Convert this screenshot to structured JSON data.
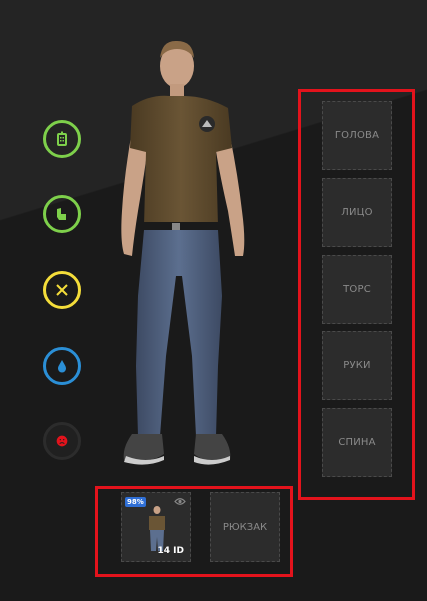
{
  "statuses": [
    {
      "name": "health",
      "icon": "health-icon",
      "color": "#7ed04b"
    },
    {
      "name": "armor",
      "icon": "armor-icon",
      "color": "#7ed04b"
    },
    {
      "name": "food",
      "icon": "food-icon",
      "color": "#f4dd3a"
    },
    {
      "name": "water",
      "icon": "water-icon",
      "color": "#2b8fd6"
    },
    {
      "name": "mood",
      "icon": "mood-icon",
      "color": "#e3131c"
    }
  ],
  "slots": {
    "head": "ГОЛОВА",
    "face": "ЛИЦО",
    "torso": "ТОРС",
    "hands": "РУКИ",
    "back": "СПИНА"
  },
  "outfit": {
    "percent": "98%",
    "id_label": "14 ID"
  },
  "backpack": {
    "label": "РЮКЗАК"
  },
  "colors": {
    "highlight_frame": "#e3131c",
    "percent_badge": "#2f6fd6"
  }
}
